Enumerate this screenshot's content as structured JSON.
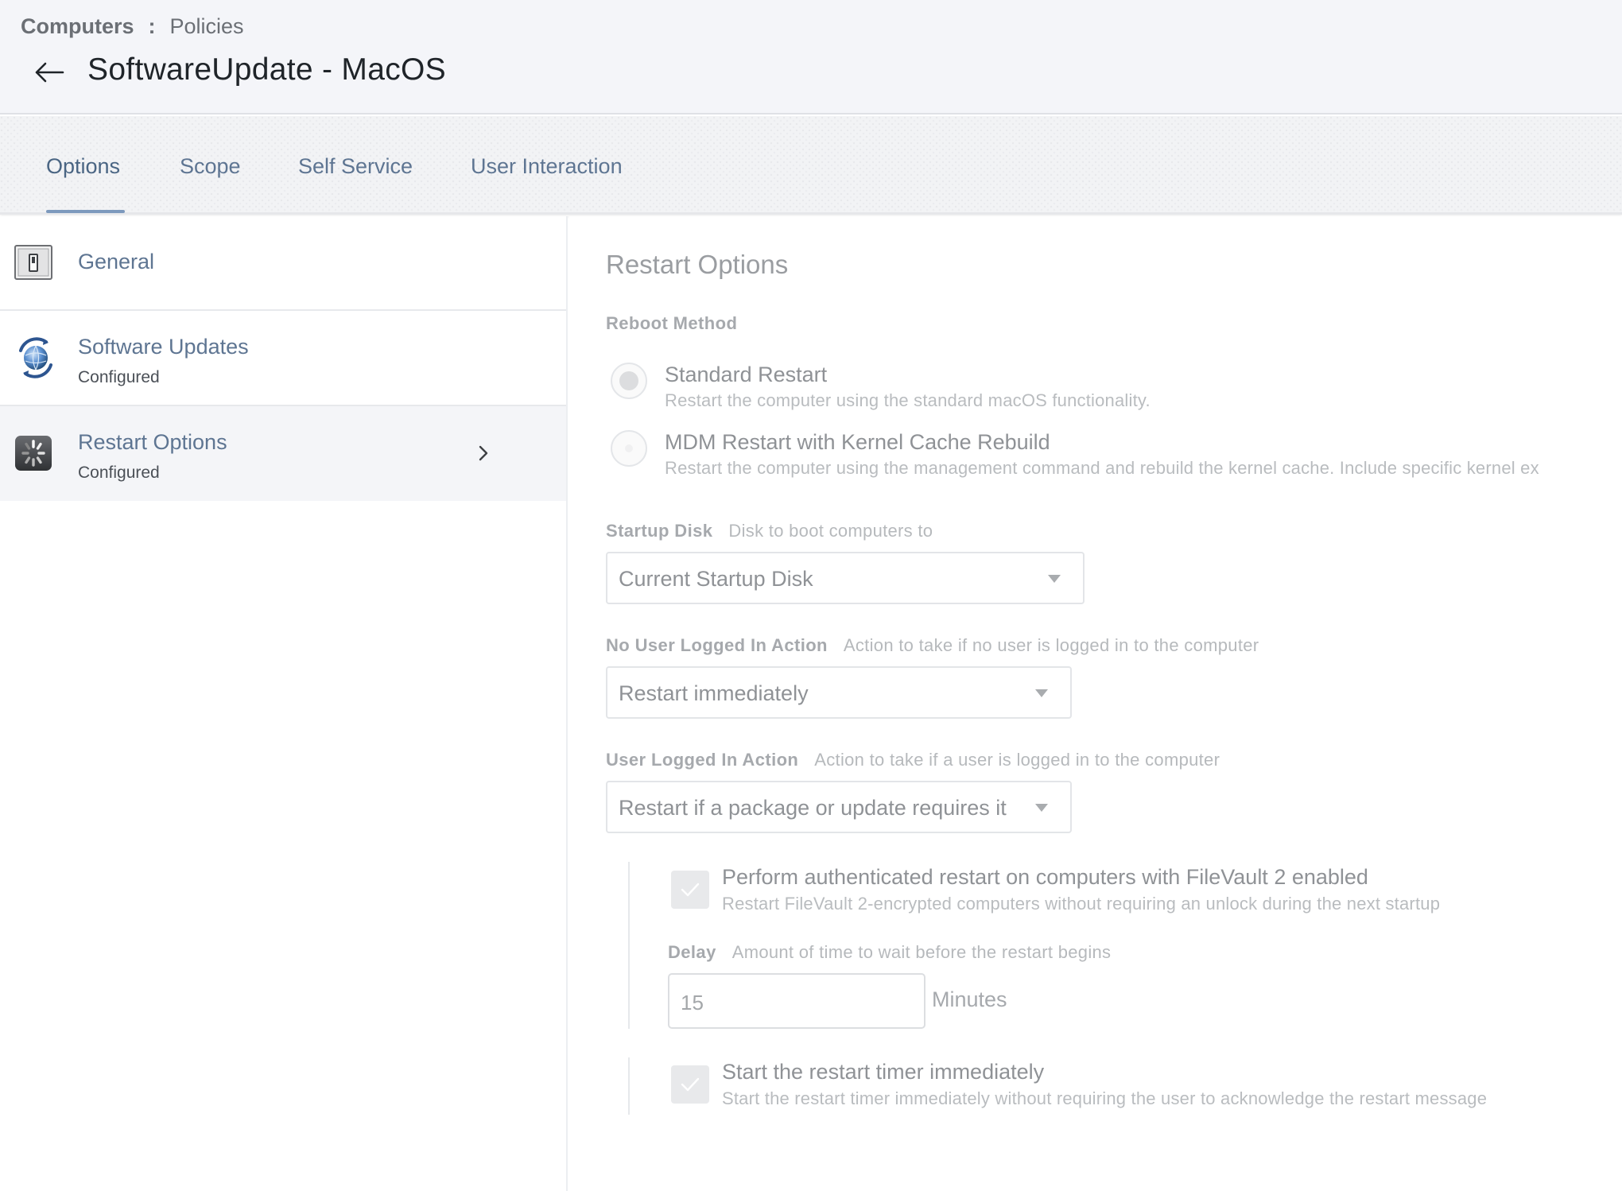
{
  "header": {
    "breadcrumb_root": "Computers",
    "breadcrumb_sep": ":",
    "breadcrumb_current": "Policies",
    "title": "SoftwareUpdate - MacOS"
  },
  "tabs": [
    {
      "label": "Options",
      "active": true
    },
    {
      "label": "Scope"
    },
    {
      "label": "Self Service"
    },
    {
      "label": "User Interaction"
    }
  ],
  "sidebar": {
    "items": [
      {
        "title": "General",
        "icon": "switch-icon"
      },
      {
        "title": "Software Updates",
        "subtitle": "Configured",
        "icon": "globe-update-icon"
      },
      {
        "title": "Restart Options",
        "subtitle": "Configured",
        "icon": "restart-spinner-icon",
        "active": true
      }
    ]
  },
  "main": {
    "section_title": "Restart Options",
    "reboot_method": {
      "label": "Reboot Method",
      "options": [
        {
          "title": "Standard Restart",
          "desc": "Restart the computer using the standard macOS functionality.",
          "selected": true
        },
        {
          "title": "MDM Restart with Kernel Cache Rebuild",
          "desc": "Restart the computer using the management command and rebuild the kernel cache. Include specific kernel ex",
          "selected": false
        }
      ]
    },
    "startup_disk": {
      "label": "Startup Disk",
      "hint": "Disk to boot computers to",
      "value": "Current Startup Disk"
    },
    "no_user_action": {
      "label": "No User Logged In Action",
      "hint": "Action to take if no user is logged in to the computer",
      "value": "Restart immediately"
    },
    "user_action": {
      "label": "User Logged In Action",
      "hint": "Action to take if a user is logged in to the computer",
      "value": "Restart if a package or update requires it"
    },
    "filevault": {
      "title": "Perform authenticated restart on computers with FileVault 2 enabled",
      "desc": "Restart FileVault 2-encrypted computers without requiring an unlock during the next startup",
      "checked": true
    },
    "delay": {
      "label": "Delay",
      "hint": "Amount of time to wait before the restart begins",
      "value": "15",
      "unit": "Minutes"
    },
    "timer": {
      "title": "Start the restart timer immediately",
      "desc": "Start the restart timer immediately without requiring the user to acknowledge the restart message",
      "checked": true
    }
  },
  "colors": {
    "accent": "#7d99bd",
    "link": "#5e7592",
    "header_bg": "#f4f5f9"
  }
}
